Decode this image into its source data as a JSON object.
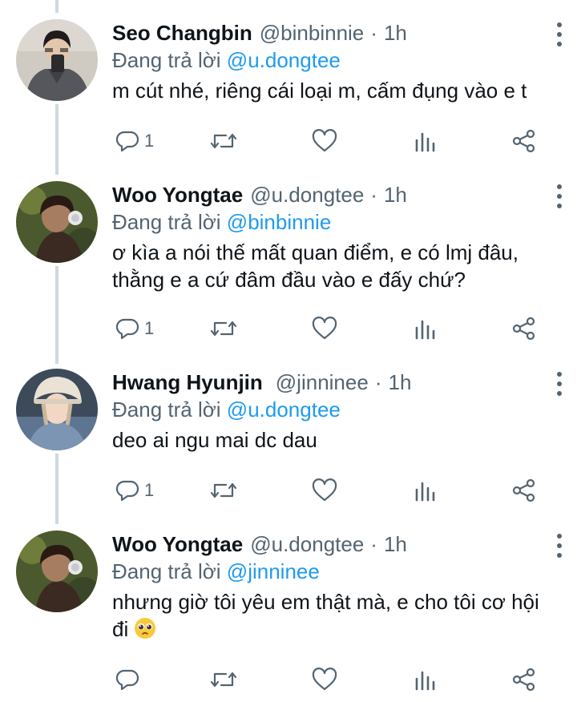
{
  "tweets": [
    {
      "name": "Seo Changbin",
      "handle": "@binbinnie",
      "time": "1h",
      "replying_label": "Đang trả lời",
      "replying_to": "@u.dongtee",
      "text": "m cút nhé, riêng cái loại m, cấm đụng vào e t",
      "reply_count": "1"
    },
    {
      "name": "Woo Yongtae",
      "handle": "@u.dongtee",
      "time": "1h",
      "replying_label": "Đang trả lời",
      "replying_to": "@binbinnie",
      "text": "ơ kìa a nói thế mất quan điểm, e có lmj đâu, thằng e a cứ đâm đầu vào e đấy chứ?",
      "reply_count": "1"
    },
    {
      "name": "Hwang Hyunjin",
      "handle": "@jinninee",
      "time": "1h",
      "replying_label": "Đang trả lời",
      "replying_to": "@u.dongtee",
      "text": "deo ai ngu mai dc dau",
      "reply_count": "1"
    },
    {
      "name": "Woo Yongtae",
      "handle": "@u.dongtee",
      "time": "1h",
      "replying_label": "Đang trả lời",
      "replying_to": "@jinninee",
      "text": "nhưng giờ tôi yêu em thật mà, e cho tôi cơ hội đi",
      "reply_count": ""
    }
  ],
  "dot_separator": "·",
  "colors": {
    "handle_gray": "#536471",
    "mention_blue": "#1d9bf0",
    "thread_line": "#cfd9de"
  },
  "icons": {
    "reply": "reply-icon",
    "retweet": "retweet-icon",
    "like": "heart-icon",
    "analytics": "analytics-icon",
    "share": "share-icon",
    "more": "more-vertical-icon",
    "emoji": "pleading-face-emoji"
  }
}
